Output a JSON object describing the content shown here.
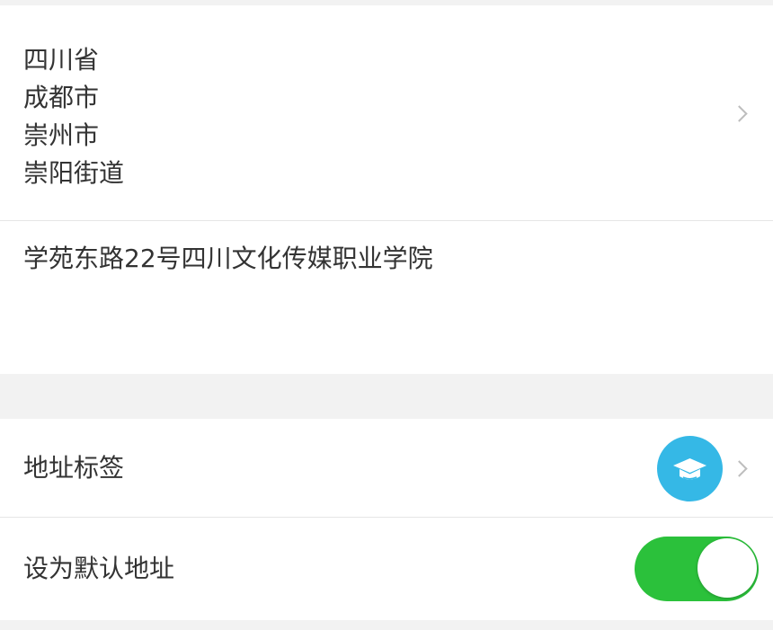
{
  "region": {
    "province": "四川省",
    "city": "成都市",
    "district": "崇州市",
    "street": "崇阳街道"
  },
  "detail_address": "学苑东路22号四川文化传媒职业学院",
  "address_tag": {
    "label": "地址标签",
    "icon": "graduation-cap-icon",
    "icon_color": "#35b8e6"
  },
  "default_address": {
    "label": "设为默认地址",
    "enabled": true,
    "toggle_color": "#2bc13b"
  }
}
